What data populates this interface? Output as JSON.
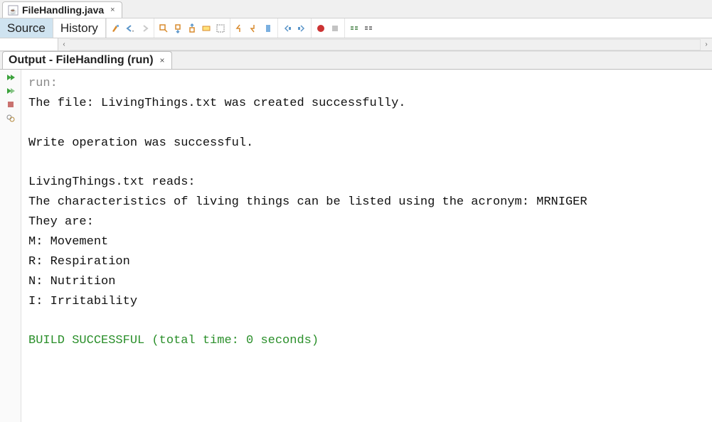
{
  "file_tab": {
    "label": "FileHandling.java",
    "close_glyph": "×"
  },
  "editor_toolbar": {
    "mode_source": "Source",
    "mode_history": "History"
  },
  "output_tab": {
    "label": "Output - FileHandling (run)",
    "close_glyph": "×"
  },
  "console": {
    "run_label": "run:",
    "lines": {
      "l1": "The file: LivingThings.txt was created successfully.",
      "l2": "",
      "l3": "Write operation was successful.",
      "l4": "",
      "l5": "LivingThings.txt reads:",
      "l6": "The characteristics of living things can be listed using the acronym: MRNIGER",
      "l7": "They are:",
      "l8": "M: Movement",
      "l9": "R: Respiration",
      "l10": "N: Nutrition",
      "l11": "I: Irritability",
      "l12": ""
    },
    "build_msg": "BUILD SUCCESSFUL (total time: 0 seconds)"
  }
}
